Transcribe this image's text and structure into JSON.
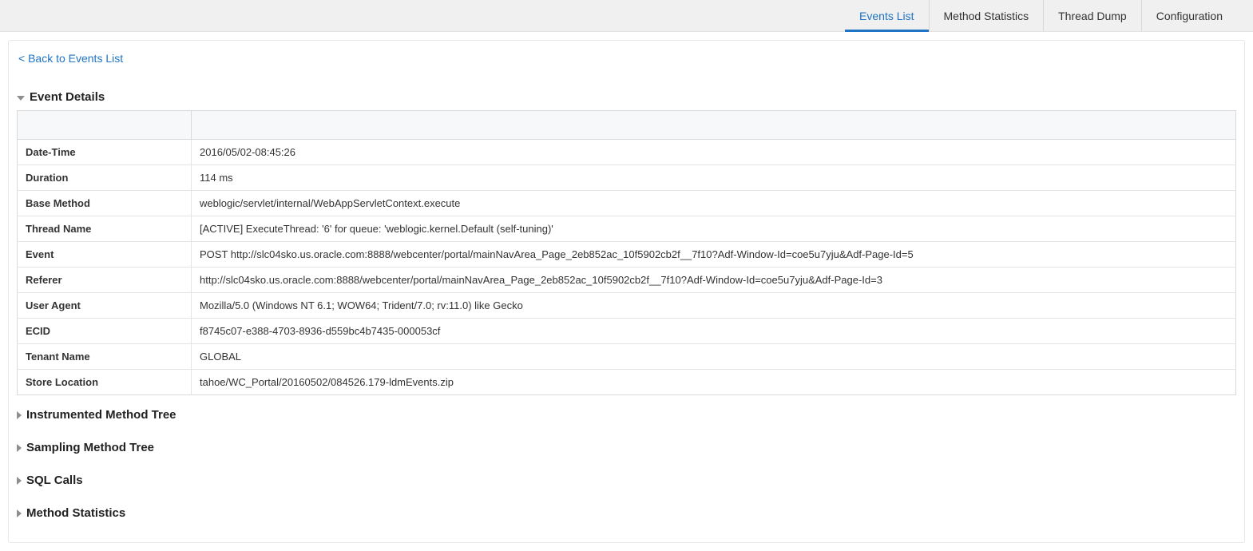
{
  "tabs": {
    "events_list": "Events List",
    "method_statistics": "Method Statistics",
    "thread_dump": "Thread Dump",
    "configuration": "Configuration"
  },
  "back_link": "< Back to Events List",
  "sections": {
    "event_details": "Event Details",
    "instrumented_method_tree": "Instrumented Method Tree",
    "sampling_method_tree": "Sampling Method Tree",
    "sql_calls": "SQL Calls",
    "method_statistics": "Method Statistics"
  },
  "details": {
    "date_time": {
      "label": "Date-Time",
      "value": "2016/05/02-08:45:26"
    },
    "duration": {
      "label": "Duration",
      "value": "114 ms"
    },
    "base_method": {
      "label": "Base Method",
      "value": "weblogic/servlet/internal/WebAppServletContext.execute"
    },
    "thread_name": {
      "label": "Thread Name",
      "value": "[ACTIVE] ExecuteThread: '6' for queue: 'weblogic.kernel.Default (self-tuning)'"
    },
    "event": {
      "label": "Event",
      "value": "POST http://slc04sko.us.oracle.com:8888/webcenter/portal/mainNavArea_Page_2eb852ac_10f5902cb2f__7f10?Adf-Window-Id=coe5u7yju&Adf-Page-Id=5"
    },
    "referer": {
      "label": "Referer",
      "value": "http://slc04sko.us.oracle.com:8888/webcenter/portal/mainNavArea_Page_2eb852ac_10f5902cb2f__7f10?Adf-Window-Id=coe5u7yju&Adf-Page-Id=3"
    },
    "user_agent": {
      "label": "User Agent",
      "value": "Mozilla/5.0 (Windows NT 6.1; WOW64; Trident/7.0; rv:11.0) like Gecko"
    },
    "ecid": {
      "label": "ECID",
      "value": "f8745c07-e388-4703-8936-d559bc4b7435-000053cf"
    },
    "tenant_name": {
      "label": "Tenant Name",
      "value": "GLOBAL"
    },
    "store_location": {
      "label": "Store Location",
      "value": "tahoe/WC_Portal/20160502/084526.179-ldmEvents.zip"
    }
  }
}
